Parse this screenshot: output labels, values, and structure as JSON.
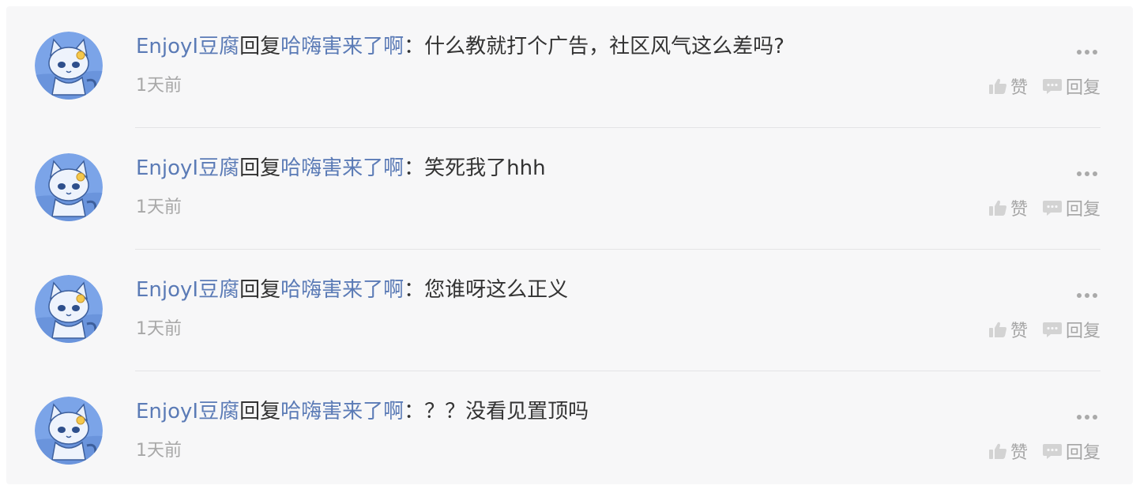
{
  "colors": {
    "panel_bg": "#f7f7f8",
    "username": "#5b7bb6",
    "text": "#333333",
    "muted": "#a7a7a7",
    "divider": "#e4e4e6"
  },
  "comments": [
    {
      "author": "EnjoyI豆腐",
      "reply_word": "回复",
      "reply_to": "哈嗨害来了啊",
      "colon": "：",
      "text": "什么教就打个广告，社区风气这么差吗?",
      "time": "1天前",
      "like_label": "赞",
      "reply_label": "回复",
      "avatar_icon": "cat-avatar-icon",
      "more_icon": "more-dots-icon",
      "like_icon": "thumbs-up-icon",
      "reply_icon": "comment-bubble-icon"
    },
    {
      "author": "EnjoyI豆腐",
      "reply_word": "回复",
      "reply_to": "哈嗨害来了啊",
      "colon": "：",
      "text": "笑死我了hhh",
      "time": "1天前",
      "like_label": "赞",
      "reply_label": "回复",
      "avatar_icon": "cat-avatar-icon",
      "more_icon": "more-dots-icon",
      "like_icon": "thumbs-up-icon",
      "reply_icon": "comment-bubble-icon"
    },
    {
      "author": "EnjoyI豆腐",
      "reply_word": "回复",
      "reply_to": "哈嗨害来了啊",
      "colon": "：",
      "text": "您谁呀这么正义",
      "time": "1天前",
      "like_label": "赞",
      "reply_label": "回复",
      "avatar_icon": "cat-avatar-icon",
      "more_icon": "more-dots-icon",
      "like_icon": "thumbs-up-icon",
      "reply_icon": "comment-bubble-icon"
    },
    {
      "author": "EnjoyI豆腐",
      "reply_word": "回复",
      "reply_to": "哈嗨害来了啊",
      "colon": "：",
      "text": "？？没看见置顶吗",
      "time": "1天前",
      "like_label": "赞",
      "reply_label": "回复",
      "avatar_icon": "cat-avatar-icon",
      "more_icon": "more-dots-icon",
      "like_icon": "thumbs-up-icon",
      "reply_icon": "comment-bubble-icon"
    }
  ]
}
